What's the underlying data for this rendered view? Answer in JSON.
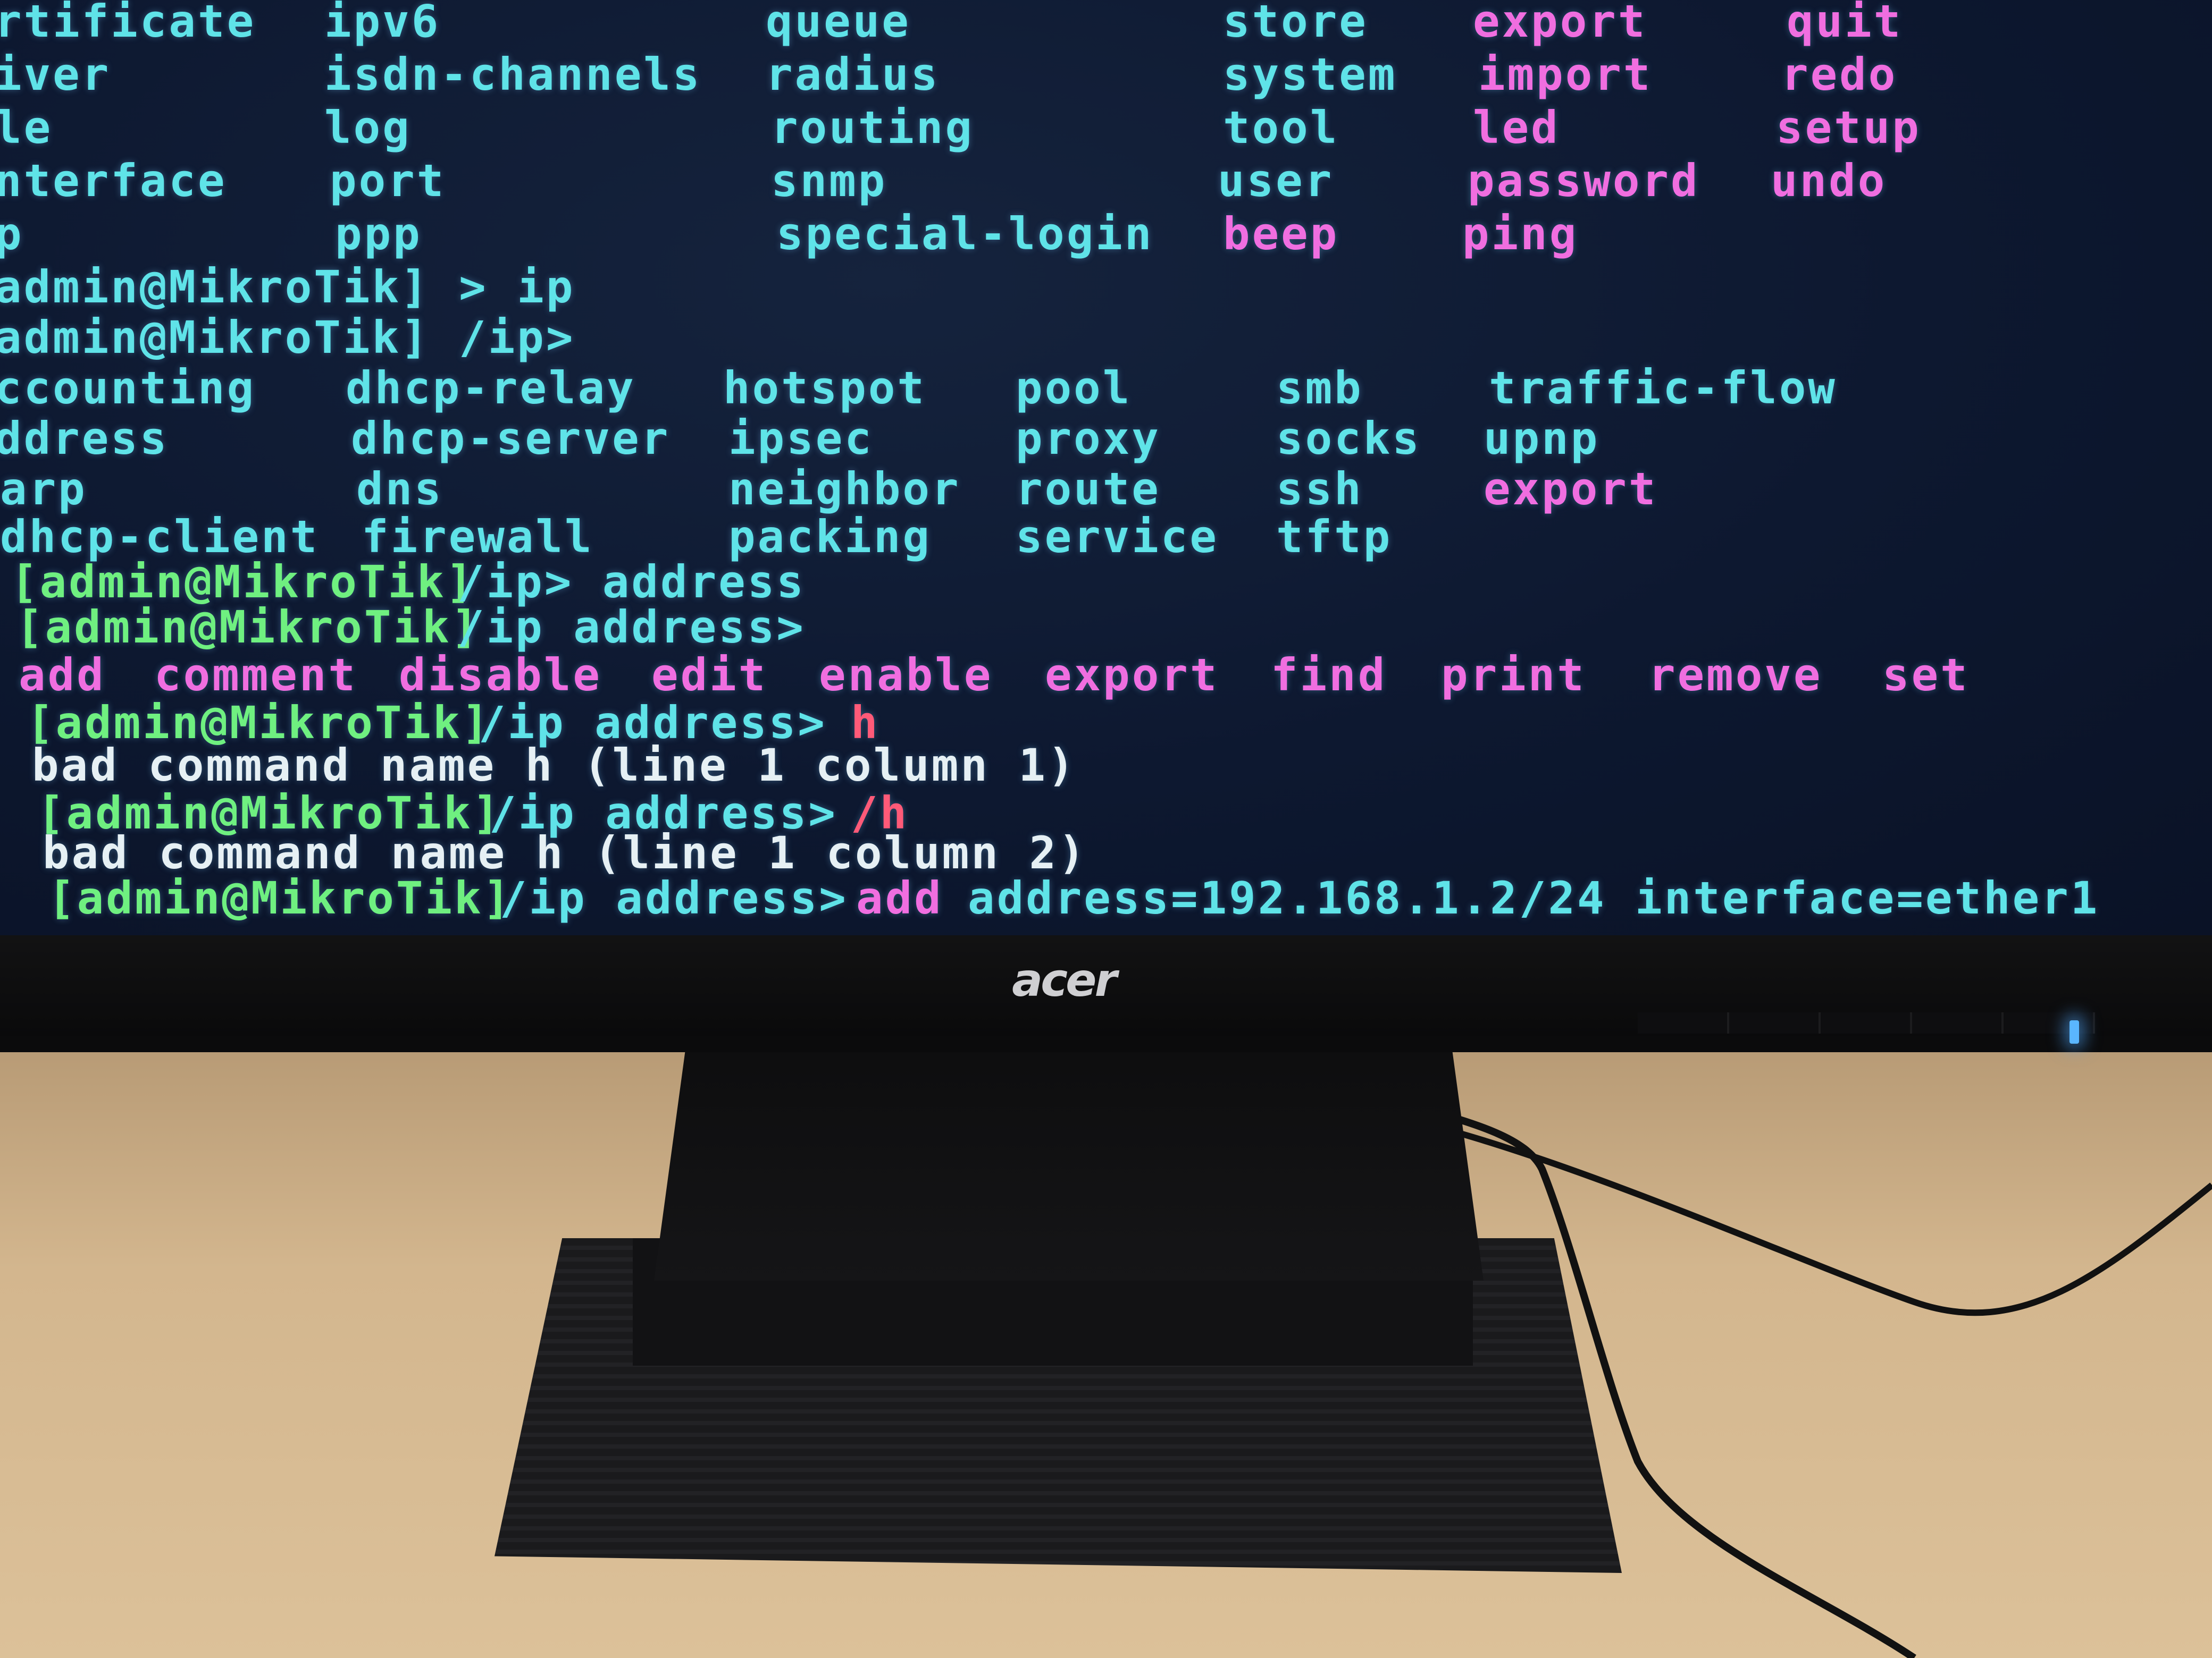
{
  "terminal": {
    "menu_rows": [
      [
        "rtificate",
        "ipv6",
        "queue",
        "store",
        "export",
        "quit"
      ],
      [
        "iver",
        "isdn-channels",
        "radius",
        "system",
        "import",
        "redo"
      ],
      [
        "le",
        "log",
        "routing",
        "tool",
        "led",
        "setup"
      ],
      [
        "nterface",
        "port",
        "snmp",
        "user",
        "password",
        "undo"
      ],
      [
        "p",
        "ppp",
        "special-login",
        "beep",
        "ping",
        ""
      ]
    ],
    "prompt_1": "admin@MikroTik] > ip",
    "prompt_2": "admin@MikroTik] /ip>",
    "ip_rows": [
      [
        "ccounting",
        "dhcp-relay",
        "hotspot",
        "pool",
        "smb",
        "traffic-flow"
      ],
      [
        "ddress",
        "dhcp-server",
        "ipsec",
        "proxy",
        "socks",
        "upnp"
      ],
      [
        "arp",
        "dns",
        "neighbor",
        "route",
        "ssh",
        "export"
      ],
      [
        "dhcp-client",
        "firewall",
        "packing",
        "service",
        "tftp",
        ""
      ]
    ],
    "prompt_3_user": "[admin@MikroTik]",
    "prompt_3_cmd": "/ip> address",
    "prompt_4_user": "[admin@MikroTik]",
    "prompt_4_cmd": "/ip address>",
    "address_cmds": [
      "add",
      "comment",
      "disable",
      "edit",
      "enable",
      "export",
      "find",
      "print",
      "remove",
      "set"
    ],
    "prompt_5_user": "[admin@MikroTik]",
    "prompt_5_cmd": "/ip address>",
    "prompt_5_input": "h",
    "error_1": "bad command name h (line 1 column 1)",
    "prompt_6_user": "[admin@MikroTik]",
    "prompt_6_cmd": "/ip address>",
    "prompt_6_input": "/h",
    "error_2": "bad command name h (line 1 column 2)",
    "prompt_7_user": "[admin@MikroTik]",
    "prompt_7_cmd": "/ip address>",
    "prompt_7_verb": "add",
    "prompt_7_args": "address=192.168.1.2/24 interface=ether1"
  },
  "monitor": {
    "brand": "acer"
  },
  "colors": {
    "cyan": "#5fe3e8",
    "magenta": "#f06ee0",
    "red": "#ff5a78",
    "green": "#6ff080",
    "led": "#5ab6ff"
  }
}
